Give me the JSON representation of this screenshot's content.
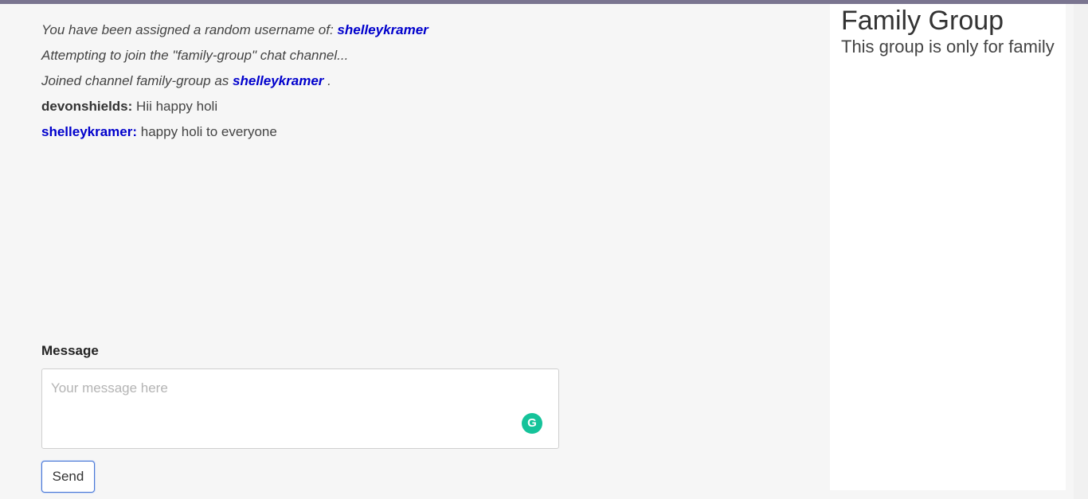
{
  "chat": {
    "system_1_prefix": "You have been assigned a random username of: ",
    "system_1_username": "shelleykramer",
    "system_2": "Attempting to join the \"family-group\" chat channel...",
    "system_3_prefix": "Joined channel family-group as ",
    "system_3_username": "shelleykramer",
    "system_3_suffix": " .",
    "messages": [
      {
        "author": "devonshields:",
        "text": " Hii happy holi"
      },
      {
        "author": "shelleykramer:",
        "text": " happy holi to everyone"
      }
    ]
  },
  "composer": {
    "label": "Message",
    "placeholder": "Your message here",
    "send_label": "Send",
    "grammarly_glyph": "G"
  },
  "sidebar": {
    "title": "Family Group",
    "description": "This group is only for family"
  },
  "colors": {
    "username": "#0000cc",
    "grammarly": "#15c39a",
    "top_stripe": "#7a7590"
  }
}
